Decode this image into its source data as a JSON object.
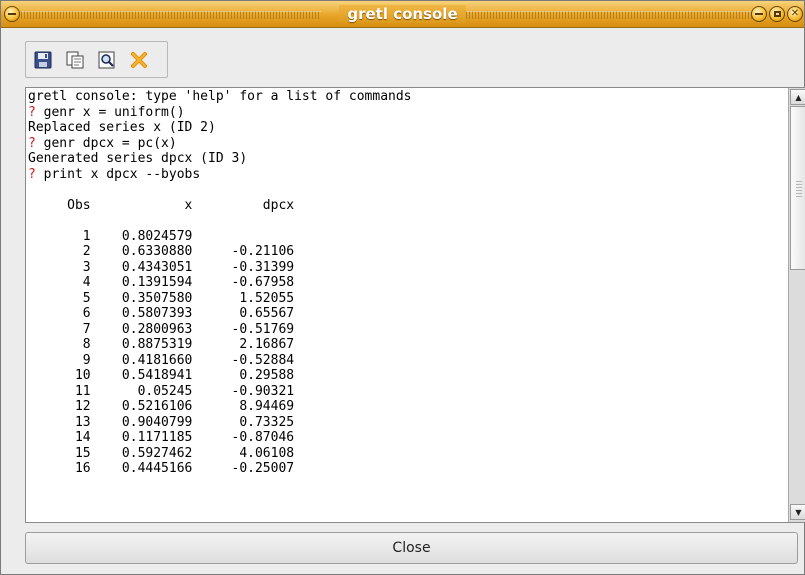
{
  "window": {
    "title": "gretl console"
  },
  "toolbar": {
    "buttons": [
      {
        "icon": "save-icon"
      },
      {
        "icon": "copy-icon"
      },
      {
        "icon": "find-icon"
      },
      {
        "icon": "close-x-icon"
      }
    ]
  },
  "console": {
    "lines": [
      {
        "prompt": "",
        "text": "gretl console: type 'help' for a list of commands"
      },
      {
        "prompt": "? ",
        "text": "genr x = uniform()"
      },
      {
        "prompt": "",
        "text": "Replaced series x (ID 2)"
      },
      {
        "prompt": "? ",
        "text": "genr dpcx = pc(x)"
      },
      {
        "prompt": "",
        "text": "Generated series dpcx (ID 3)"
      },
      {
        "prompt": "? ",
        "text": "print x dpcx --byobs"
      },
      {
        "prompt": "",
        "text": ""
      },
      {
        "prompt": "",
        "text": "     Obs            x         dpcx"
      },
      {
        "prompt": "",
        "text": ""
      },
      {
        "prompt": "",
        "text": "       1    0.8024579"
      },
      {
        "prompt": "",
        "text": "       2    0.6330880     -0.21106"
      },
      {
        "prompt": "",
        "text": "       3    0.4343051     -0.31399"
      },
      {
        "prompt": "",
        "text": "       4    0.1391594     -0.67958"
      },
      {
        "prompt": "",
        "text": "       5    0.3507580      1.52055"
      },
      {
        "prompt": "",
        "text": "       6    0.5807393      0.65567"
      },
      {
        "prompt": "",
        "text": "       7    0.2800963     -0.51769"
      },
      {
        "prompt": "",
        "text": "       8    0.8875319      2.16867"
      },
      {
        "prompt": "",
        "text": "       9    0.4181660     -0.52884"
      },
      {
        "prompt": "",
        "text": "      10    0.5418941      0.29588"
      },
      {
        "prompt": "",
        "text": "      11      0.05245     -0.90321"
      },
      {
        "prompt": "",
        "text": "      12    0.5216106      8.94469"
      },
      {
        "prompt": "",
        "text": "      13    0.9040799      0.73325"
      },
      {
        "prompt": "",
        "text": "      14    0.1171185     -0.87046"
      },
      {
        "prompt": "",
        "text": "      15    0.5927462      4.06108"
      },
      {
        "prompt": "",
        "text": "      16    0.4445166     -0.25007"
      }
    ]
  },
  "footer": {
    "close_label": "Close"
  },
  "colors": {
    "titlebar": "#e8a528",
    "prompt": "#c81e1e"
  }
}
